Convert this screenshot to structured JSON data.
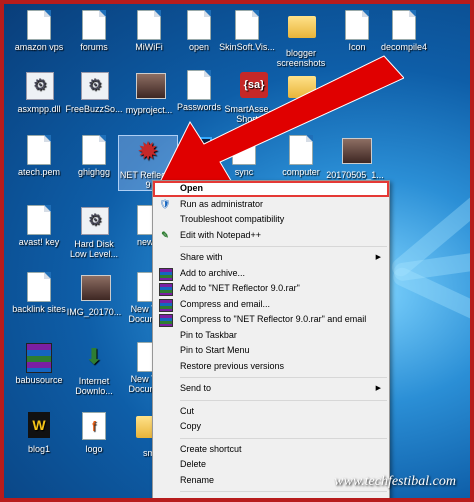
{
  "desktop": {
    "icons": [
      {
        "label": "amazon vps",
        "kind": "doc"
      },
      {
        "label": "forums",
        "kind": "doc"
      },
      {
        "label": "MiWiFi",
        "kind": "doc"
      },
      {
        "label": "open",
        "kind": "doc"
      },
      {
        "label": "SkinSoft.Vis...",
        "kind": "doc"
      },
      {
        "label": "blogger screenshots",
        "kind": "folder"
      },
      {
        "label": "Icon",
        "kind": "doc"
      },
      {
        "label": "decompile4",
        "kind": "doc"
      },
      {
        "label": "asxmpp.dll",
        "kind": "gearsm"
      },
      {
        "label": "FreeBuzzSo...",
        "kind": "gearsm"
      },
      {
        "label": "myproject...",
        "kind": "thumb"
      },
      {
        "label": "Passwords",
        "kind": "doc"
      },
      {
        "label": "SmartAsse... - Shortcut",
        "badge": "{sa}",
        "kind": "sa"
      },
      {
        "label": "YouTube",
        "kind": "folder"
      },
      {
        "label": "atech.pem",
        "kind": "doc"
      },
      {
        "label": "ghighgg",
        "kind": "doc"
      },
      {
        "label": "NET Reflector 9",
        "kind": "gear"
      },
      {
        "label": "Photoshop",
        "badge": "Ps",
        "kind": "ps"
      },
      {
        "label": "sync",
        "kind": "doc"
      },
      {
        "label": "computer",
        "kind": "doc"
      },
      {
        "label": "20170505_1...",
        "kind": "thumb"
      },
      {
        "label": "avast! key",
        "kind": "doc"
      },
      {
        "label": "Hard Disk Low Level...",
        "kind": "gearsm"
      },
      {
        "label": "new 1",
        "kind": "doc"
      },
      {
        "label": "backlink sites",
        "kind": "doc"
      },
      {
        "label": "IMG_20170...",
        "kind": "thumb"
      },
      {
        "label": "New Text Docume...",
        "kind": "doc"
      },
      {
        "label": "babusource",
        "kind": "rar"
      },
      {
        "label": "Internet Downlo...",
        "kind": "idm"
      },
      {
        "label": "New Text Docume...",
        "kind": "doc"
      },
      {
        "label": "blog1",
        "kind": "word"
      },
      {
        "label": "logo",
        "kind": "fav"
      },
      {
        "label": "sm",
        "kind": "folder"
      }
    ]
  },
  "context_menu": {
    "items": [
      {
        "label": "Open",
        "bold": true,
        "selected": true
      },
      {
        "label": "Run as administrator",
        "icon": "shield"
      },
      {
        "label": "Troubleshoot compatibility"
      },
      {
        "label": "Edit with Notepad++",
        "icon": "notepad"
      },
      {
        "sep": true
      },
      {
        "label": "Share with",
        "submenu": true
      },
      {
        "label": "Add to archive...",
        "icon": "rar"
      },
      {
        "label": "Add to \"NET Reflector 9.0.rar\"",
        "icon": "rar"
      },
      {
        "label": "Compress and email...",
        "icon": "rar"
      },
      {
        "label": "Compress to \"NET Reflector 9.0.rar\" and email",
        "icon": "rar"
      },
      {
        "label": "Pin to Taskbar"
      },
      {
        "label": "Pin to Start Menu"
      },
      {
        "label": "Restore previous versions"
      },
      {
        "sep": true
      },
      {
        "label": "Send to",
        "submenu": true
      },
      {
        "sep": true
      },
      {
        "label": "Cut"
      },
      {
        "label": "Copy"
      },
      {
        "sep": true
      },
      {
        "label": "Create shortcut"
      },
      {
        "label": "Delete"
      },
      {
        "label": "Rename"
      },
      {
        "sep": true
      },
      {
        "label": "Properties"
      }
    ]
  },
  "watermark": "www.techfestibal.com",
  "colors": {
    "arrow": "#e00000",
    "frame": "#b71c1c",
    "selection_outline": "#e53935"
  }
}
